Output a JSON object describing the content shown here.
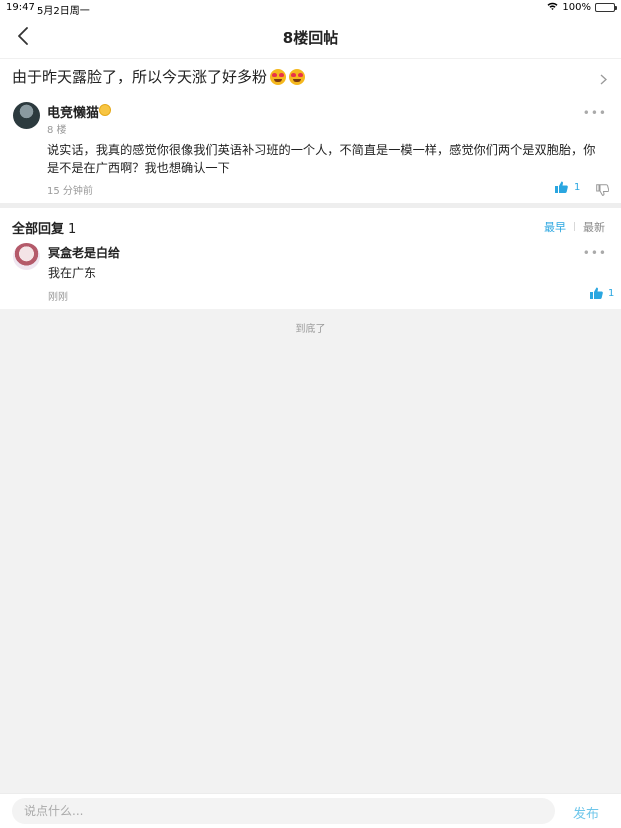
{
  "status_bar": {
    "time": "19:47",
    "date": "5月2日周一",
    "battery": "100%"
  },
  "nav": {
    "title": "8楼回帖"
  },
  "thread": {
    "title": "由于昨天露脸了，所以今天涨了好多粉"
  },
  "post": {
    "author": "电竞懒猫",
    "floor": "8 楼",
    "body": "说实话，我真的感觉你很像我们英语补习班的一个人，不简直是一模一样，感觉你们两个是双胞胎，你是不是在广西啊？我也想确认一下",
    "time": "15 分钟前",
    "likes": "1"
  },
  "replies": {
    "label": "全部回复",
    "count": "1",
    "sort_earliest": "最早",
    "sort_latest": "最新",
    "items": [
      {
        "author": "冥盒老是白给",
        "text": "我在广东",
        "time": "刚刚",
        "likes": "1"
      }
    ]
  },
  "end_text": "到底了",
  "input_bar": {
    "placeholder": "说点什么...",
    "publish_label": "发布"
  },
  "colors": {
    "accent": "#2aa6e0",
    "publish": "#6ec6ea",
    "background": "#f2f2f2"
  },
  "icons": {
    "back": "chevron-left-icon",
    "thread_arrow": "chevron-right-icon",
    "more": "more-dots-icon",
    "like": "thumbs-up-icon",
    "dislike": "thumbs-down-icon",
    "wifi": "wifi-icon",
    "battery": "battery-icon"
  }
}
